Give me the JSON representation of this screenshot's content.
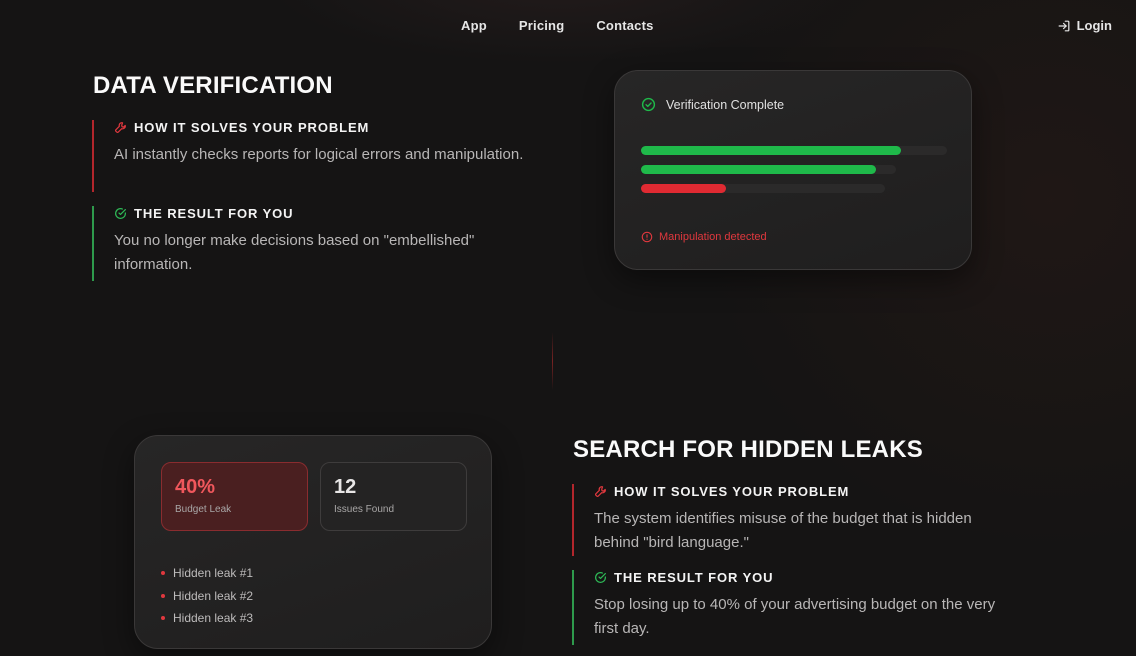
{
  "nav": {
    "links": [
      "App",
      "Pricing",
      "Contacts"
    ],
    "login_label": "Login",
    "login_icon": "login-arrow-icon"
  },
  "section1": {
    "title": "DATA VERIFICATION",
    "problem": {
      "heading": "HOW IT SOLVES YOUR PROBLEM",
      "icon": "wrench-icon",
      "text": "AI instantly checks reports for logical errors and manipulation."
    },
    "result": {
      "heading": "THE RESULT FOR YOU",
      "icon": "check-circle-icon",
      "text": "You no longer make decisions based on \"embellished\" information."
    },
    "card": {
      "status": "Verification Complete",
      "status_icon": "check-circle-icon",
      "bars": [
        {
          "fill": 0.85,
          "color": "#1fb94a"
        },
        {
          "fill": 0.92,
          "color": "#1fb94a"
        },
        {
          "fill": 0.35,
          "color": "#e02a32"
        }
      ],
      "warning": "Manipulation detected",
      "warning_icon": "alert-circle-icon"
    }
  },
  "section2": {
    "title": "SEARCH FOR HIDDEN LEAKS",
    "problem": {
      "heading": "HOW IT SOLVES YOUR PROBLEM",
      "icon": "wrench-icon",
      "text": "The system identifies misuse of the budget that is hidden behind \"bird language.\""
    },
    "result": {
      "heading": "THE RESULT FOR YOU",
      "icon": "check-circle-icon",
      "text": "Stop losing up to 40% of your advertising budget on the very first day."
    },
    "card": {
      "stats": [
        {
          "value": "40%",
          "label": "Budget Leak"
        },
        {
          "value": "12",
          "label": "Issues Found"
        }
      ],
      "leaks": [
        "Hidden leak #1",
        "Hidden leak #2",
        "Hidden leak #3"
      ]
    }
  },
  "colors": {
    "accent_red": "#e0383e",
    "accent_green": "#1fb94a",
    "background": "#151414"
  }
}
